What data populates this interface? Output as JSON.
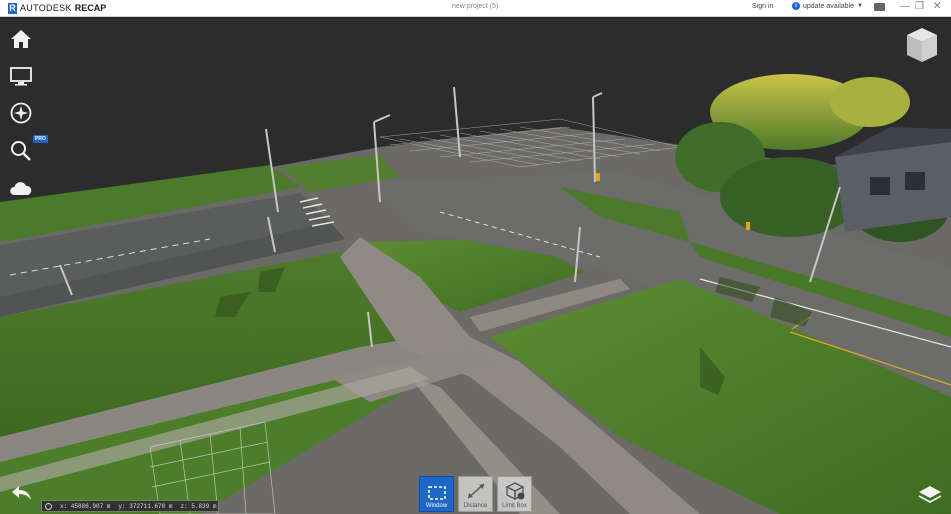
{
  "titlebar": {
    "brand_autodesk": "AUTODESK",
    "brand_recap": "RECAP",
    "document_title": "new project (5)",
    "sign_in": "Sign in",
    "update": "update available",
    "minimize": "—",
    "restore": "❐",
    "close": "✕"
  },
  "left_toolbar": {
    "items": [
      {
        "name": "home",
        "icon": "home-icon"
      },
      {
        "name": "display",
        "icon": "monitor-icon"
      },
      {
        "name": "navigation",
        "icon": "compass-icon"
      },
      {
        "name": "search",
        "icon": "magnifier-icon",
        "badge": "PRO"
      },
      {
        "name": "cloud",
        "icon": "cloud-icon"
      }
    ]
  },
  "coordinates": {
    "x": "x: 45886.907 m",
    "y": "y: 372711.678 m",
    "z": "z: 5.839 m"
  },
  "bottom_tools": [
    {
      "label": "Window",
      "icon": "window-select-icon",
      "active": true
    },
    {
      "label": "Distance",
      "icon": "distance-icon",
      "active": false
    },
    {
      "label": "Limit Box",
      "icon": "limit-box-icon",
      "active": false
    }
  ],
  "colors": {
    "accent": "#1e66c8",
    "background": "#2c2c2c"
  }
}
